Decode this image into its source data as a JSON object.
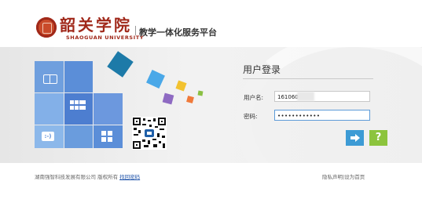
{
  "header": {
    "logo_cn": "韶关学院",
    "logo_en": "SHAOGUAN  UNIVERSITY",
    "platform_title": "教学一体化服务平台"
  },
  "login": {
    "title": "用户登录",
    "username_label": "用户名:",
    "username_value": "1610605",
    "password_label": "密码:",
    "password_value": "••••••••••••",
    "help_label": "?"
  },
  "footer": {
    "company": "湖南强智科技发展有限公司 版权所有",
    "retrieve_password": "找回密码",
    "privacy": "隐私声明",
    "set_homepage": "设为首页",
    "separator": "|"
  },
  "colors": {
    "brand": "#a0281a",
    "login_button": "#3d9bd5",
    "help_button": "#8cc43d"
  }
}
